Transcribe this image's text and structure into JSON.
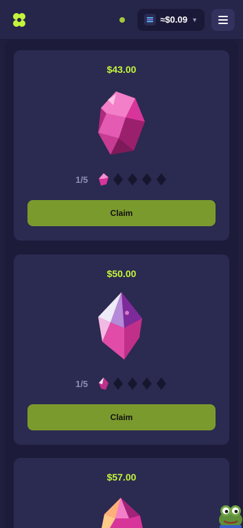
{
  "header": {
    "balance": "≈$0.09",
    "icons": {
      "logo": "clover-logo-icon",
      "coin": "coin-icon",
      "menu": "hamburger-menu-icon"
    },
    "accent": "#c3f53c"
  },
  "cards": [
    {
      "price": "$43.00",
      "progress": "1/5",
      "filled": 1,
      "total": 5,
      "claim_label": "Claim"
    },
    {
      "price": "$50.00",
      "progress": "1/5",
      "filled": 1,
      "total": 5,
      "claim_label": "Claim"
    },
    {
      "price": "$57.00"
    }
  ],
  "colors": {
    "claim_button": "#7b9a2d",
    "price_text": "#c3f53c",
    "gem": "#d8359b"
  }
}
